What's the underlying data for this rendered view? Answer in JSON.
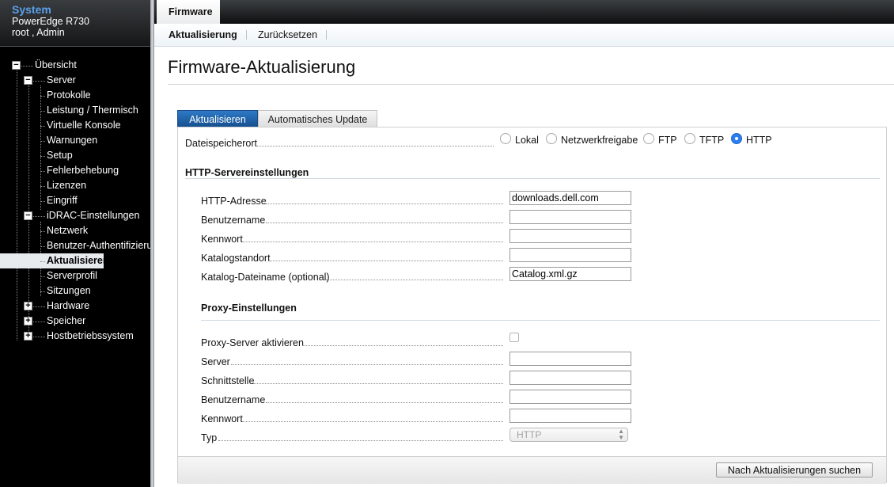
{
  "sidebar": {
    "title": "System",
    "model": "PowerEdge R730",
    "user": "root , Admin",
    "tree": [
      {
        "label": "Übersicht",
        "level": 0,
        "toggle": "−"
      },
      {
        "label": "Server",
        "level": 1,
        "toggle": "−"
      },
      {
        "label": "Protokolle",
        "level": 2
      },
      {
        "label": "Leistung / Thermisch",
        "level": 2
      },
      {
        "label": "Virtuelle Konsole",
        "level": 2
      },
      {
        "label": "Warnungen",
        "level": 2
      },
      {
        "label": "Setup",
        "level": 2
      },
      {
        "label": "Fehlerbehebung",
        "level": 2
      },
      {
        "label": "Lizenzen",
        "level": 2
      },
      {
        "label": "Eingriff",
        "level": 2
      },
      {
        "label": "iDRAC-Einstellungen",
        "level": 1,
        "toggle": "−"
      },
      {
        "label": "Netzwerk",
        "level": 2
      },
      {
        "label": "Benutzer-Authentifizierung",
        "level": 2
      },
      {
        "label": "Aktualisieren und Zurücksetzen",
        "level": 2,
        "selected": true
      },
      {
        "label": "Serverprofil",
        "level": 2
      },
      {
        "label": "Sitzungen",
        "level": 2
      },
      {
        "label": "Hardware",
        "level": 1,
        "toggle": "+"
      },
      {
        "label": "Speicher",
        "level": 1,
        "toggle": "+"
      },
      {
        "label": "Hostbetriebssystem",
        "level": 1,
        "toggle": "+"
      }
    ]
  },
  "top_tabs": {
    "firmware": "Firmware"
  },
  "subnav": {
    "update": "Aktualisierung",
    "reset": "Zurücksetzen"
  },
  "page": {
    "title": "Firmware-Aktualisierung"
  },
  "inner_tabs": {
    "update": "Aktualisieren",
    "auto_update": "Automatisches Update"
  },
  "storage": {
    "label": "Dateispeicherort",
    "options": [
      "Lokal",
      "Netzwerkfreigabe",
      "FTP",
      "TFTP",
      "HTTP"
    ],
    "selected": "HTTP"
  },
  "http_settings": {
    "title": "HTTP-Servereinstellungen",
    "address_label": "HTTP-Adresse",
    "address_value": "downloads.dell.com",
    "username_label": "Benutzername",
    "username_value": "",
    "password_label": "Kennwort",
    "password_value": "",
    "catalog_location_label": "Katalogstandort",
    "catalog_location_value": "",
    "catalog_filename_label": "Katalog-Dateiname (optional)",
    "catalog_filename_value": "Catalog.xml.gz"
  },
  "proxy_settings": {
    "title": "Proxy-Einstellungen",
    "enable_label": "Proxy-Server aktivieren",
    "enabled": false,
    "server_label": "Server",
    "server_value": "",
    "port_label": "Schnittstelle",
    "port_value": "",
    "username_label": "Benutzername",
    "username_value": "",
    "password_label": "Kennwort",
    "password_value": "",
    "type_label": "Typ",
    "type_value": "HTTP"
  },
  "actions": {
    "check_updates": "Nach Aktualisierungen suchen"
  },
  "colors": {
    "accent": "#2f79c6",
    "sidebar_title": "#5aa0ea",
    "selected_bg": "#e8ebee"
  }
}
